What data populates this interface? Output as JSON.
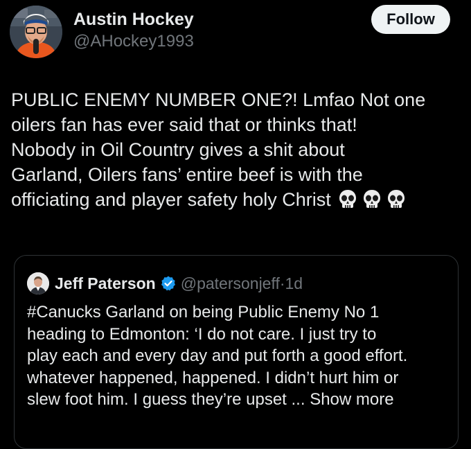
{
  "author": {
    "name": "Austin Hockey",
    "handle": "@AHockey1993",
    "follow_label": "Follow"
  },
  "tweet": {
    "lines": [
      "PUBLIC ENEMY NUMBER ONE?! Lmfao Not one",
      "oilers fan has ever said that or thinks that!",
      "Nobody in Oil Country gives a shit about",
      "Garland, Oilers fans’ entire beef is with the",
      "officiating and player safety holy Christ"
    ],
    "emoji": [
      "skull-icon",
      "skull-icon",
      "skull-icon"
    ]
  },
  "quote": {
    "name": "Jeff Paterson",
    "handle": "@patersonjeff",
    "separator": "·",
    "time": "1d",
    "lines": [
      "#Canucks Garland on being Public Enemy No 1",
      "heading to Edmonton: ‘I do not care. I just try to",
      "play each and every day and put forth a good effort.",
      "whatever happened, happened. I didn’t hurt him or",
      "slew foot him. I guess they’re upset ... "
    ],
    "show_more_label": "Show more"
  },
  "colors": {
    "background": "#000000",
    "text_primary": "#e7e9ea",
    "text_secondary": "#71767b",
    "border": "#2f3336",
    "follow_bg": "#eff3f4",
    "verified": "#1d9bf0"
  }
}
